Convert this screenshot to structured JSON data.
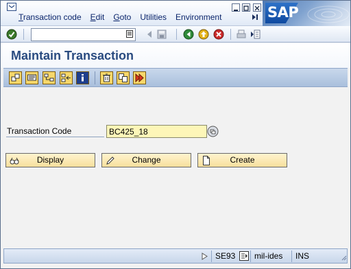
{
  "menu": {
    "items": [
      {
        "mnemonic": "T",
        "rest": "ransaction code"
      },
      {
        "mnemonic": "E",
        "rest": "dit"
      },
      {
        "mnemonic": "G",
        "rest": "oto"
      },
      {
        "mnemonic": "",
        "rest": "Utilities"
      },
      {
        "mnemonic": "",
        "rest": "Environment"
      }
    ]
  },
  "logo": {
    "text": "SAP"
  },
  "standard_toolbar": {
    "command_value": "",
    "icons": [
      "enter-icon",
      "command-history-icon",
      "back-icon",
      "save-icon",
      "back-green-icon",
      "exit-icon",
      "cancel-icon",
      "print-icon",
      "find-icon"
    ]
  },
  "page": {
    "title": "Maintain Transaction"
  },
  "app_toolbar": {
    "icons": [
      "other-object-icon",
      "display-object-icon",
      "hierarchy-icon",
      "where-used-icon",
      "information-icon",
      "delete-icon",
      "copy-icon",
      "execute-icon"
    ]
  },
  "form": {
    "tcode_label": "Transaction Code",
    "tcode_value": "BC425_18"
  },
  "actions": {
    "display_label": "Display",
    "change_label": "Change",
    "create_label": "Create"
  },
  "status": {
    "tcode": "SE93",
    "server": "mil-ides",
    "mode": "INS"
  },
  "colors": {
    "title": "#2a4b80",
    "required_field": "#fdf6b8",
    "app_toolbar": "#b9cde6",
    "action_button": "#f7df9c"
  }
}
